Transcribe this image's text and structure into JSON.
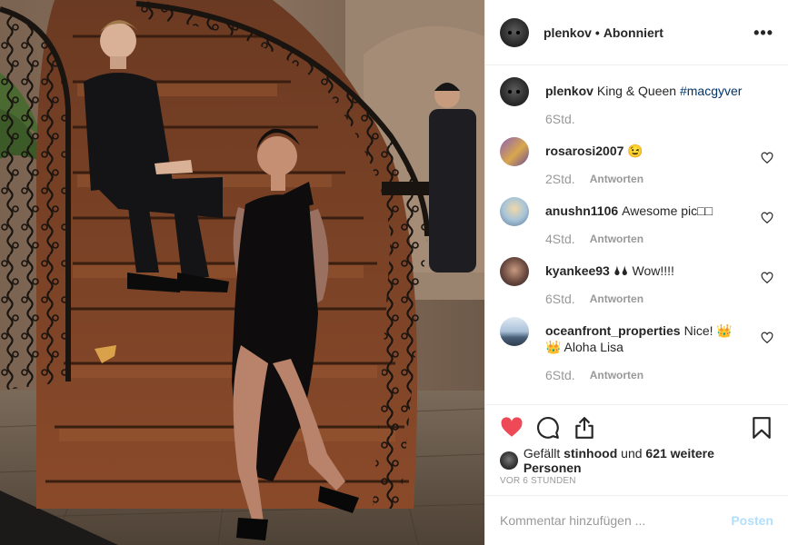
{
  "header": {
    "username": "plenkov",
    "separator": "•",
    "follow_status": "Abonniert",
    "more_icon": "more-horizontal-icon"
  },
  "caption": {
    "username": "plenkov",
    "text": "King & Queen",
    "hashtag": "#macgyver",
    "time": "6Std."
  },
  "comments": [
    {
      "username": "rosarosi2007",
      "text": "😉",
      "time": "2Std.",
      "reply_label": "Antworten"
    },
    {
      "username": "anushn1106",
      "text": "Awesome pic□□",
      "time": "4Std.",
      "reply_label": "Antworten"
    },
    {
      "username": "kyankee93",
      "text": "🌢🌢 Wow!!!!",
      "time": "6Std.",
      "reply_label": "Antworten"
    },
    {
      "username": "oceanfront_properties",
      "text": "Nice! 👑👑 Aloha Lisa",
      "time": "6Std.",
      "reply_label": "Antworten"
    }
  ],
  "likes": {
    "prefix": "Gefällt ",
    "first_user": "stinhood",
    "middle": " und ",
    "count": "621 weitere Personen"
  },
  "time_ago": "VOR 6 STUNDEN",
  "comment_input": {
    "placeholder": "Kommentar hinzufügen ...",
    "post_label": "Posten"
  },
  "colors": {
    "liked_heart": "#ed4956",
    "post_disabled": "#b2dffc",
    "hashtag": "#003569",
    "muted": "#999999"
  }
}
